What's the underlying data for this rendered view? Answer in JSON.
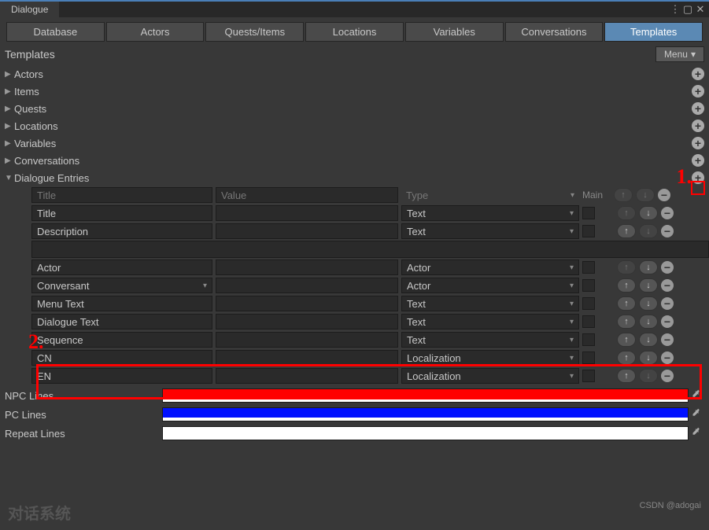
{
  "window": {
    "title": "Dialogue"
  },
  "tabs": [
    "Database",
    "Actors",
    "Quests/Items",
    "Locations",
    "Variables",
    "Conversations",
    "Templates"
  ],
  "active_tab": "Templates",
  "section": {
    "title": "Templates",
    "menu_label": "Menu"
  },
  "tree": [
    "Actors",
    "Items",
    "Quests",
    "Locations",
    "Variables",
    "Conversations",
    "Dialogue Entries"
  ],
  "grid_headers": {
    "title": "Title",
    "value": "Value",
    "type": "Type",
    "main": "Main"
  },
  "rows1": [
    {
      "title": "Title",
      "value": "",
      "type": "Text"
    },
    {
      "title": "Description",
      "value": "",
      "type": "Text"
    }
  ],
  "rows2": [
    {
      "title": "Actor",
      "value": "",
      "type": "Actor"
    },
    {
      "title": "Conversant",
      "value": "",
      "type": "Actor",
      "title_dd": true
    },
    {
      "title": "Menu Text",
      "value": "",
      "type": "Text"
    },
    {
      "title": "Dialogue Text",
      "value": "",
      "type": "Text"
    },
    {
      "title": "Sequence",
      "value": "",
      "type": "Text"
    },
    {
      "title": "CN",
      "value": "",
      "type": "Localization"
    },
    {
      "title": "EN",
      "value": "",
      "type": "Localization"
    }
  ],
  "colors": [
    {
      "label": "NPC Lines",
      "hex": "#ff0000"
    },
    {
      "label": "PC Lines",
      "hex": "#0010ff"
    },
    {
      "label": "Repeat Lines",
      "hex": "#ffffff"
    }
  ],
  "annotations": {
    "one": "1.",
    "two": "2."
  },
  "footer": {
    "left": "对话系统",
    "right": "CSDN @adogai"
  }
}
